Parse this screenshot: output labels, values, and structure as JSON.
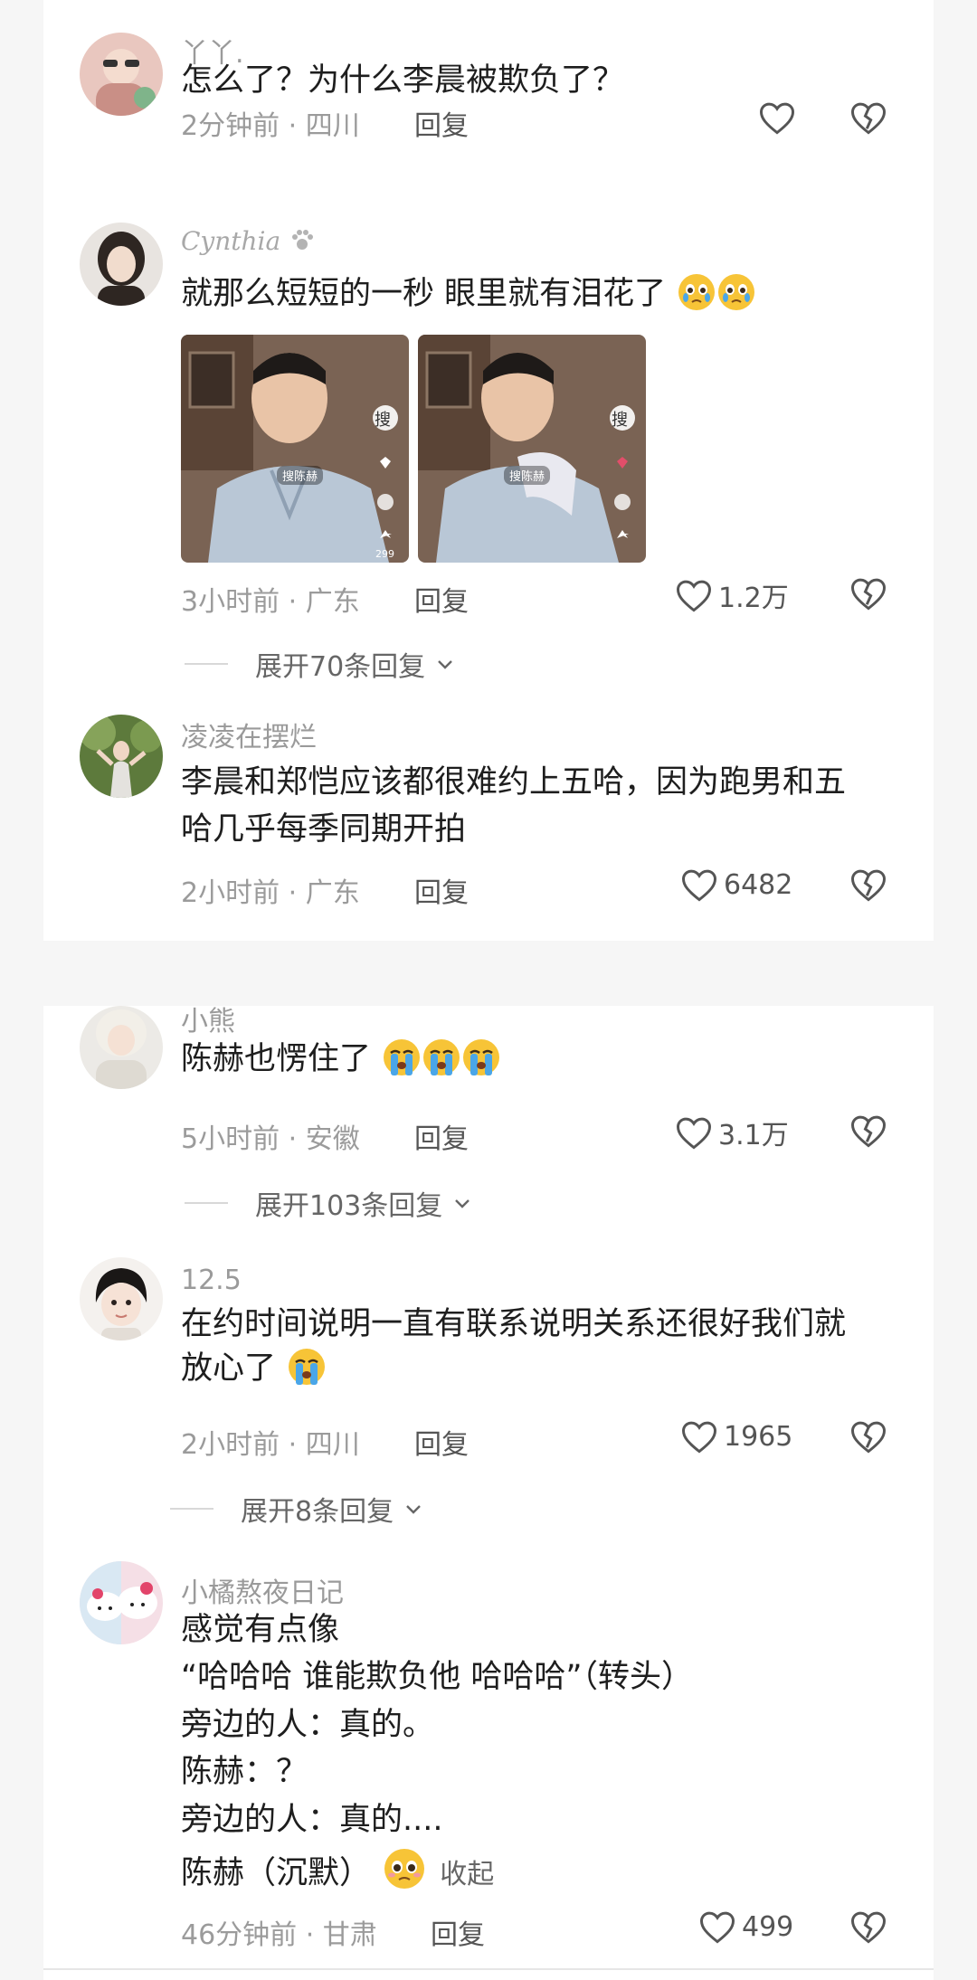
{
  "colors": {
    "background": "#f6f6f6",
    "card": "#ffffff",
    "meta_text": "#9b9b9b",
    "emoji_yellow": "#f7c437",
    "emoji_tear": "#4aa6e8"
  },
  "comments": [
    {
      "username": "丫丫.",
      "lines": [
        "怎么了？为什么李晨被欺负了？"
      ],
      "time": "2分钟前",
      "location": "四川",
      "reply": "回复",
      "likes": ""
    },
    {
      "username": "Cynthia",
      "lines": [
        "就那么短短的一秒 眼里就有泪花了"
      ],
      "emojis": [
        "teary-emoji",
        "teary-emoji"
      ],
      "thumb_badge": "搜",
      "thumb_search": "搜陈赫",
      "thumb_count": "299",
      "time": "3小时前",
      "location": "广东",
      "reply": "回复",
      "likes": "1.2万",
      "expand": "展开70条回复"
    },
    {
      "username": "凌凌在摆烂",
      "lines": [
        "李晨和郑恺应该都很难约上五哈，因为跑男和五",
        "哈几乎每季同期开拍"
      ],
      "time": "2小时前",
      "location": "广东",
      "reply": "回复",
      "likes": "6482"
    },
    {
      "username": "小熊",
      "lines": [
        "陈赫也愣住了"
      ],
      "emojis": [
        "crying-emoji",
        "crying-emoji",
        "crying-emoji"
      ],
      "time": "5小时前",
      "location": "安徽",
      "reply": "回复",
      "likes": "3.1万",
      "expand": "展开103条回复"
    },
    {
      "username": "12.5",
      "lines": [
        "在约时间说明一直有联系说明关系还很好我们就",
        "放心了"
      ],
      "emojis": [
        "crying-emoji"
      ],
      "time": "2小时前",
      "location": "四川",
      "reply": "回复",
      "likes": "1965",
      "expand": "展开8条回复"
    },
    {
      "username": "小橘熬夜日记",
      "lines": [
        "感觉有点像",
        "“哈哈哈 谁能欺负他 哈哈哈”（转头）",
        "旁边的人：真的。",
        "陈赫：？",
        "旁边的人：真的....",
        "陈赫（沉默）"
      ],
      "emojis": [
        "pleading-emoji"
      ],
      "collapse": "收起",
      "time": "46分钟前",
      "location": "甘肃",
      "reply": "回复",
      "likes": "499"
    }
  ]
}
